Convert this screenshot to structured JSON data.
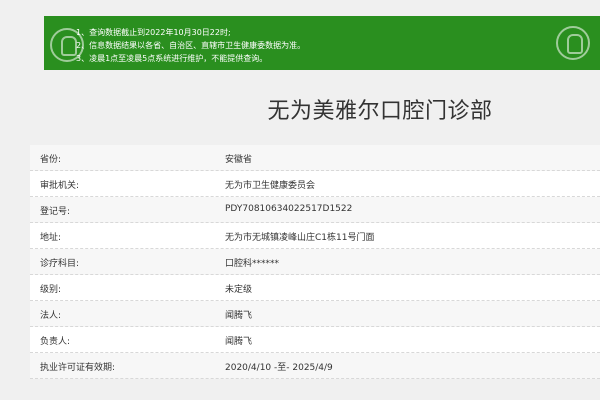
{
  "notice": {
    "lines": [
      "1、查询数据截止到2022年10月30日22时;",
      "2、信息数据结果以各省、自治区、直辖市卫生健康委数据为准。",
      "3、凌晨1点至凌晨5点系统进行维护，不能提供查询。"
    ],
    "bg_color": "#2a8f1f"
  },
  "title": "无为美雅尔口腔门诊部",
  "rows": [
    {
      "label": "省份:",
      "value": "安徽省"
    },
    {
      "label": "审批机关:",
      "value": "无为市卫生健康委员会"
    },
    {
      "label": "登记号:",
      "value": "PDY70810634022517D1522"
    },
    {
      "label": "地址:",
      "value": "无为市无城镇凌峰山庄C1栋11号门面"
    },
    {
      "label": "诊疗科目:",
      "value": "口腔科******"
    },
    {
      "label": "级别:",
      "value": "未定级"
    },
    {
      "label": "法人:",
      "value": "闻腾飞"
    },
    {
      "label": "负责人:",
      "value": "闻腾飞"
    },
    {
      "label": "执业许可证有效期:",
      "value": "2020/4/10 -至- 2025/4/9"
    }
  ]
}
